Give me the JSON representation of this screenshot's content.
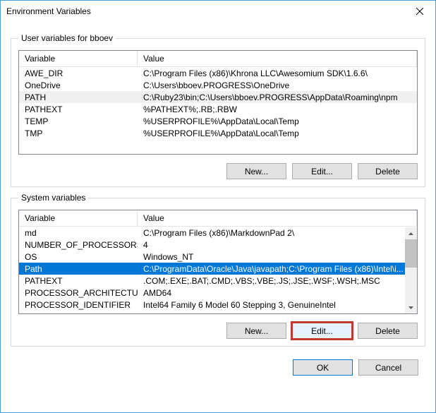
{
  "window": {
    "title": "Environment Variables"
  },
  "user_section": {
    "legend": "User variables for bboev",
    "columns": {
      "variable": "Variable",
      "value": "Value"
    },
    "rows": [
      {
        "variable": "AWE_DIR",
        "value": "C:\\Program Files (x86)\\Khrona LLC\\Awesomium SDK\\1.6.6\\"
      },
      {
        "variable": "OneDrive",
        "value": "C:\\Users\\bboev.PROGRESS\\OneDrive"
      },
      {
        "variable": "PATH",
        "value": "C:\\Ruby23\\bin;C:\\Users\\bboev.PROGRESS\\AppData\\Roaming\\npm"
      },
      {
        "variable": "PATHEXT",
        "value": "%PATHEXT%;.RB;.RBW"
      },
      {
        "variable": "TEMP",
        "value": "%USERPROFILE%\\AppData\\Local\\Temp"
      },
      {
        "variable": "TMP",
        "value": "%USERPROFILE%\\AppData\\Local\\Temp"
      }
    ],
    "selected_index": 2,
    "buttons": {
      "new": "New...",
      "edit": "Edit...",
      "delete": "Delete"
    }
  },
  "system_section": {
    "legend": "System variables",
    "columns": {
      "variable": "Variable",
      "value": "Value"
    },
    "rows": [
      {
        "variable": "md",
        "value": "C:\\Program Files (x86)\\MarkdownPad 2\\"
      },
      {
        "variable": "NUMBER_OF_PROCESSORS",
        "value": "4"
      },
      {
        "variable": "OS",
        "value": "Windows_NT"
      },
      {
        "variable": "Path",
        "value": "C:\\ProgramData\\Oracle\\Java\\javapath;C:\\Program Files (x86)\\Intel\\i..."
      },
      {
        "variable": "PATHEXT",
        "value": ".COM;.EXE;.BAT;.CMD;.VBS;.VBE;.JS;.JSE;.WSF;.WSH;.MSC"
      },
      {
        "variable": "PROCESSOR_ARCHITECTURE",
        "value": "AMD64"
      },
      {
        "variable": "PROCESSOR_IDENTIFIER",
        "value": "Intel64 Family 6 Model 60 Stepping 3, GenuineIntel"
      }
    ],
    "selected_index": 3,
    "buttons": {
      "new": "New...",
      "edit": "Edit...",
      "delete": "Delete"
    }
  },
  "dialog_buttons": {
    "ok": "OK",
    "cancel": "Cancel"
  }
}
